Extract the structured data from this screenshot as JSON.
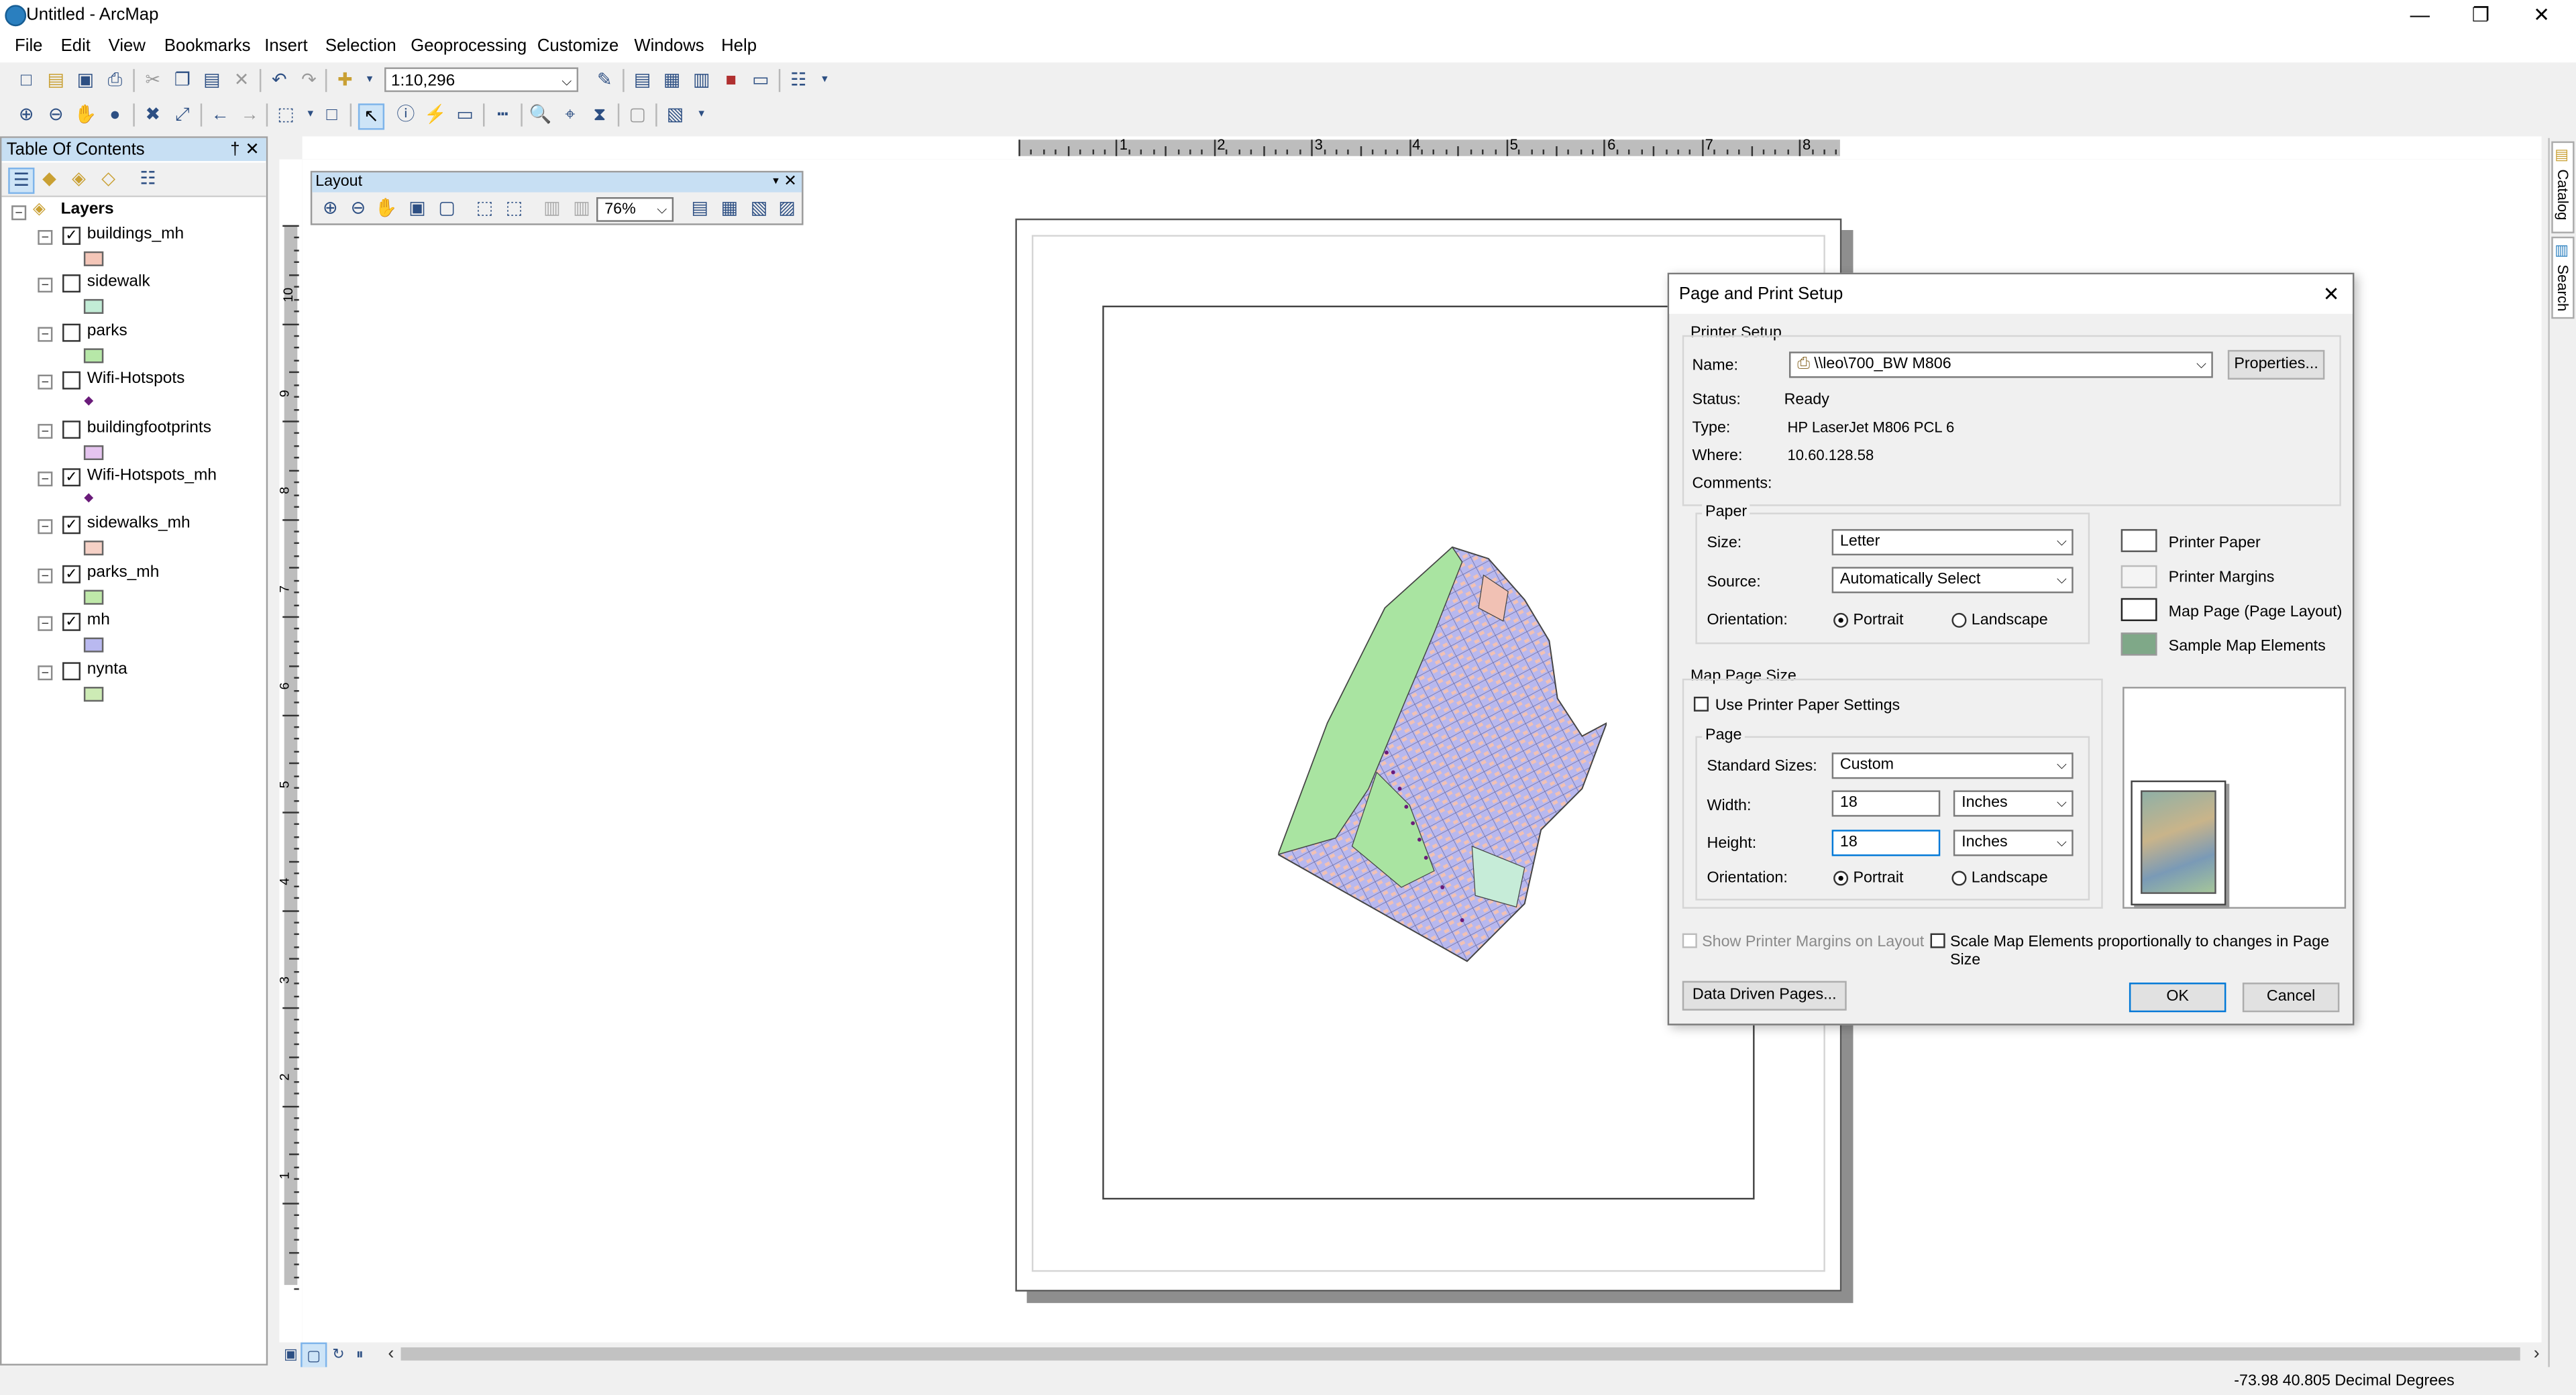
{
  "app": {
    "title": "Untitled - ArcMap"
  },
  "menu": [
    "File",
    "Edit",
    "View",
    "Bookmarks",
    "Insert",
    "Selection",
    "Geoprocessing",
    "Customize",
    "Windows",
    "Help"
  ],
  "toolbar": {
    "scale": "1:10,296"
  },
  "toc": {
    "title": "Table Of Contents",
    "root": "Layers",
    "layers": [
      {
        "name": "buildings_mh",
        "checked": true,
        "color": "#f4c6b8",
        "type": "poly"
      },
      {
        "name": "sidewalk",
        "checked": false,
        "color": "#c2ecd6",
        "type": "poly"
      },
      {
        "name": "parks",
        "checked": false,
        "color": "#b7e8a8",
        "type": "poly"
      },
      {
        "name": "Wifi-Hotspots",
        "checked": false,
        "color": "#6a1b7a",
        "type": "point"
      },
      {
        "name": "buildingfootprints",
        "checked": false,
        "color": "#e5c4ef",
        "type": "poly"
      },
      {
        "name": "Wifi-Hotspots_mh",
        "checked": true,
        "color": "#6a1b7a",
        "type": "point"
      },
      {
        "name": "sidewalks_mh",
        "checked": true,
        "color": "#f6d1c6",
        "type": "poly"
      },
      {
        "name": "parks_mh",
        "checked": true,
        "color": "#bfe8a9",
        "type": "poly"
      },
      {
        "name": "mh",
        "checked": true,
        "color": "#b9b9f0",
        "type": "poly"
      },
      {
        "name": "nynta",
        "checked": false,
        "color": "#cdebb5",
        "type": "poly"
      }
    ]
  },
  "layout_toolbar": {
    "title": "Layout",
    "zoom": "76%"
  },
  "ruler": {
    "h": [
      "1",
      "2",
      "3",
      "4",
      "5",
      "6",
      "7",
      "8"
    ],
    "v": [
      "10",
      "9",
      "8",
      "7",
      "6",
      "5",
      "4",
      "3",
      "2",
      "1"
    ]
  },
  "dialog": {
    "title": "Page and Print Setup",
    "printer_setup": "Printer Setup",
    "name_label": "Name:",
    "printer_name": "\\\\leo\\700_BW M806",
    "properties_btn": "Properties...",
    "status_label": "Status:",
    "status": "Ready",
    "type_label": "Type:",
    "type": "HP LaserJet M806 PCL 6",
    "where_label": "Where:",
    "where": "10.60.128.58",
    "comments_label": "Comments:",
    "paper_label": "Paper",
    "size_label": "Size:",
    "size": "Letter",
    "source_label": "Source:",
    "source": "Automatically Select",
    "orientation_label": "Orientation:",
    "portrait": "Portrait",
    "landscape": "Landscape",
    "legend": [
      "Printer Paper",
      "Printer Margins",
      "Map Page (Page Layout)",
      "Sample Map Elements"
    ],
    "map_page_size": "Map Page Size",
    "use_printer_paper": "Use Printer Paper Settings",
    "page_label": "Page",
    "standard_sizes_label": "Standard Sizes:",
    "standard_size": "Custom",
    "width_label": "Width:",
    "width": "18",
    "width_unit": "Inches",
    "height_label": "Height:",
    "height": "18",
    "height_unit": "Inches",
    "show_margins": "Show Printer Margins on Layout",
    "scale_elements": "Scale Map Elements proportionally to changes in Page Size",
    "ddp_btn": "Data Driven Pages...",
    "ok": "OK",
    "cancel": "Cancel"
  },
  "catalog": {
    "catalog": "Catalog",
    "search": "Search"
  },
  "status": {
    "coords": "-73.98  40.805 Decimal Degrees"
  }
}
